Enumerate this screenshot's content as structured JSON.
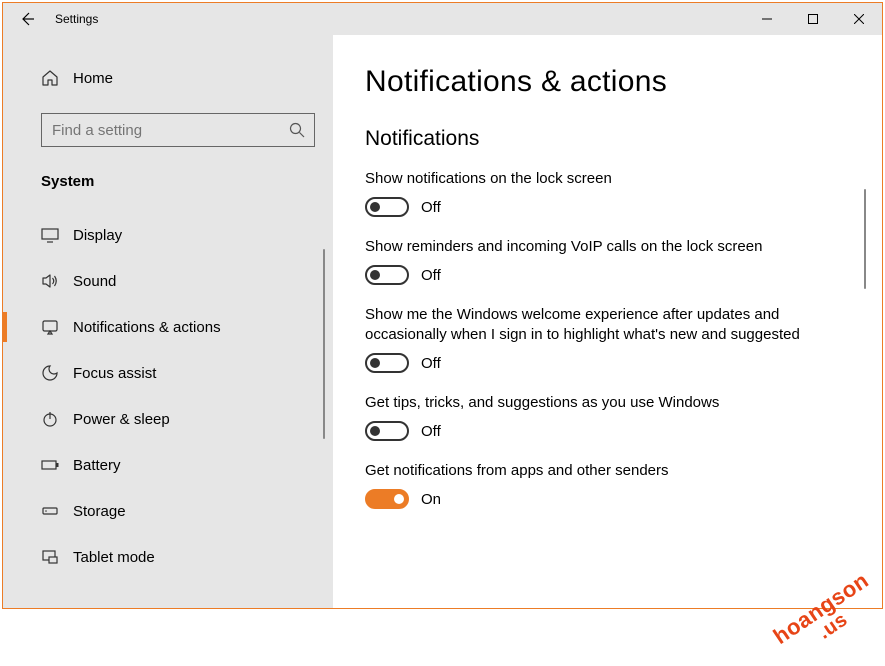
{
  "window": {
    "title": "Settings",
    "accent_color": "#ec7c26"
  },
  "sidebar": {
    "home_label": "Home",
    "search_placeholder": "Find a setting",
    "category": "System",
    "items": [
      {
        "icon": "display",
        "label": "Display"
      },
      {
        "icon": "sound",
        "label": "Sound"
      },
      {
        "icon": "notifications",
        "label": "Notifications & actions",
        "active": true
      },
      {
        "icon": "focus",
        "label": "Focus assist"
      },
      {
        "icon": "power",
        "label": "Power & sleep"
      },
      {
        "icon": "battery",
        "label": "Battery"
      },
      {
        "icon": "storage",
        "label": "Storage"
      },
      {
        "icon": "tablet",
        "label": "Tablet mode"
      }
    ]
  },
  "main": {
    "heading": "Notifications & actions",
    "section_title": "Notifications",
    "settings": [
      {
        "label": "Show notifications on the lock screen",
        "on": false,
        "state": "Off"
      },
      {
        "label": "Show reminders and incoming VoIP calls on the lock screen",
        "on": false,
        "state": "Off"
      },
      {
        "label": "Show me the Windows welcome experience after updates and occasionally when I sign in to highlight what's new and suggested",
        "on": false,
        "state": "Off"
      },
      {
        "label": "Get tips, tricks, and suggestions as you use Windows",
        "on": false,
        "state": "Off"
      },
      {
        "label": "Get notifications from apps and other senders",
        "on": true,
        "state": "On"
      }
    ]
  },
  "watermark": {
    "line1": "hoangson",
    "line2": ".us"
  }
}
